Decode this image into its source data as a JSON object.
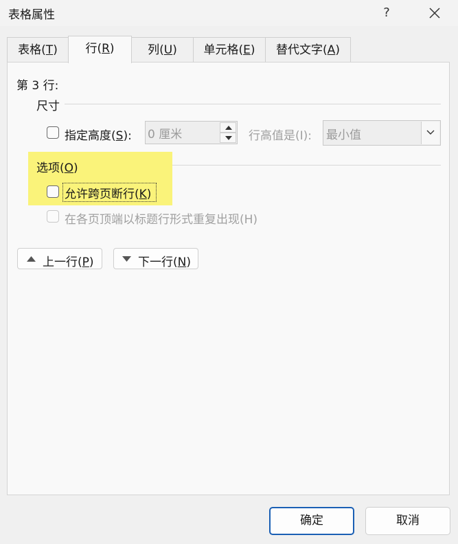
{
  "window": {
    "title": "表格属性",
    "help": "?"
  },
  "tabs": [
    {
      "label": "表格(",
      "key": "T",
      "tail": ")"
    },
    {
      "label": "行(",
      "key": "R",
      "tail": ")"
    },
    {
      "label": "列(",
      "key": "U",
      "tail": ")"
    },
    {
      "label": "单元格(",
      "key": "E",
      "tail": ")"
    },
    {
      "label": "替代文字(",
      "key": "A",
      "tail": ")"
    }
  ],
  "row_panel": {
    "row_heading": "第 3 行:",
    "size_group": "尺寸",
    "specify_height": {
      "label": "指定高度(",
      "key": "S",
      "tail": "):",
      "checked": false
    },
    "height_value": "0 厘米",
    "row_height_is_label": "行高值是(I):",
    "row_height_is_value": "最小值",
    "options_group": {
      "label": "选项(",
      "key": "O",
      "tail": ")"
    },
    "allow_break": {
      "label": "允许跨页断行(",
      "key": "K",
      "tail": ")",
      "checked": false
    },
    "repeat_header": {
      "label": "在各页顶端以标题行形式重复出现(H)",
      "checked": false,
      "enabled": false
    },
    "prev_row": {
      "label": "上一行(",
      "key": "P",
      "tail": ")"
    },
    "next_row": {
      "label": "下一行(",
      "key": "N",
      "tail": ")"
    }
  },
  "footer": {
    "ok": "确定",
    "cancel": "取消"
  },
  "colors": {
    "highlight": "#faf37a",
    "primary_border": "#1a5fb4"
  }
}
